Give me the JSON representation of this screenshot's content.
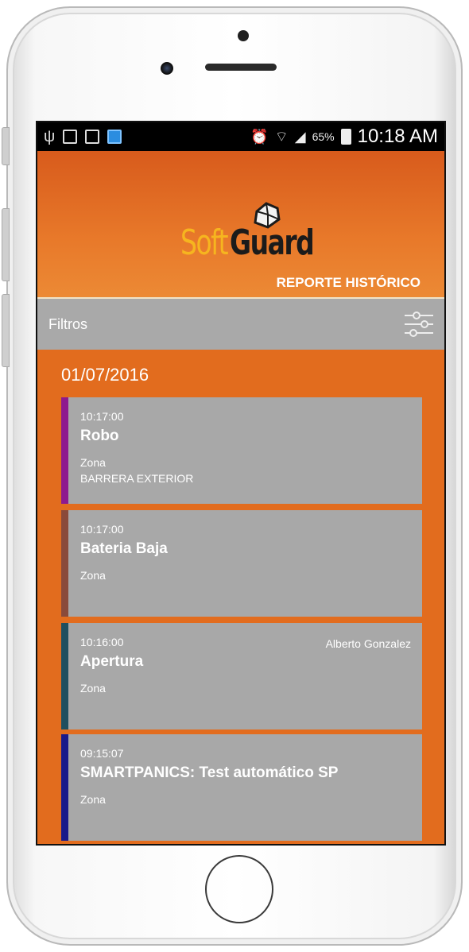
{
  "statusbar": {
    "battery_pct": "65%",
    "time": "10:18 AM",
    "icons": [
      "usb-icon",
      "gallery-icon",
      "clipboard-icon",
      "app-icon",
      "alarm-icon",
      "wifi-icon",
      "signal-icon",
      "battery-icon"
    ]
  },
  "header": {
    "logo_soft": "Soft",
    "logo_guard": "Guard",
    "title": "REPORTE HISTÓRICO"
  },
  "filters": {
    "label": "Filtros",
    "icon": "sliders-icon"
  },
  "list": {
    "date": "01/07/2016",
    "events": [
      {
        "time": "10:17:00",
        "event": "Robo",
        "zone_label": "Zona",
        "zone_value": "BARRERA EXTERIOR",
        "user": "",
        "color": "#8e1a8e"
      },
      {
        "time": "10:17:00",
        "event": "Bateria Baja",
        "zone_label": "Zona",
        "zone_value": "",
        "user": "",
        "color": "#8a4a3a"
      },
      {
        "time": "10:16:00",
        "event": "Apertura",
        "zone_label": "Zona",
        "zone_value": "",
        "user": "Alberto Gonzalez",
        "color": "#1f4f5f"
      },
      {
        "time": "09:15:07",
        "event": "SMARTPANICS: Test automático SP",
        "zone_label": "Zona",
        "zone_value": "",
        "user": "",
        "color": "#1a1a8a"
      }
    ]
  }
}
